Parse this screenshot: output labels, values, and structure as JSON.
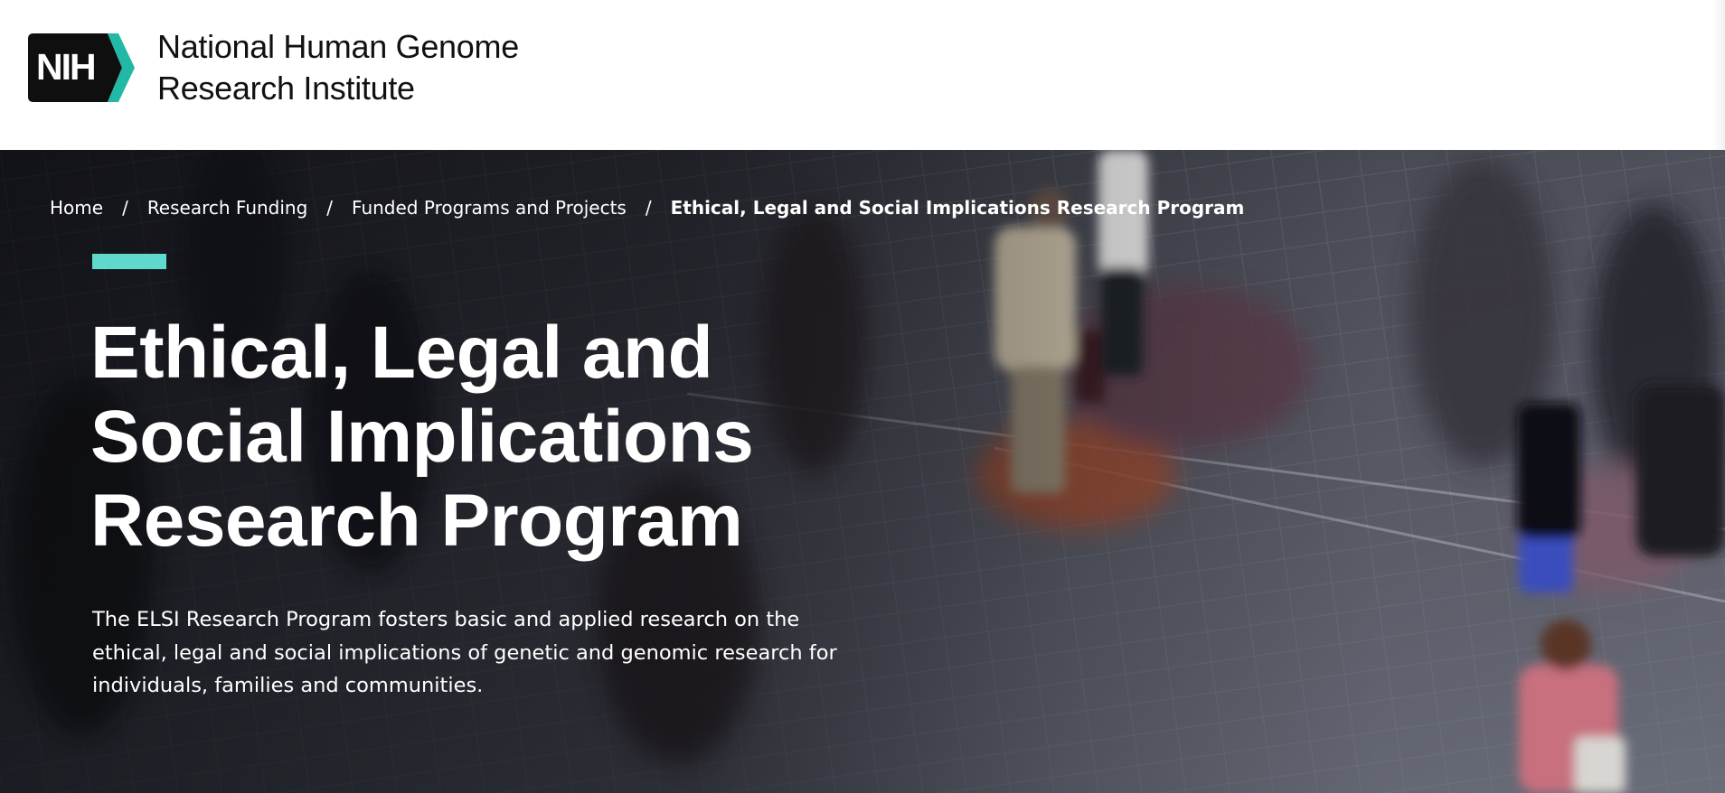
{
  "header": {
    "logo": {
      "badge_text": "NIH",
      "badge_color": "#0f0f0f",
      "chevron_color": "#21b8a6"
    },
    "org_name_lines": [
      "National Human Genome",
      "Research Institute"
    ]
  },
  "breadcrumb": {
    "items": [
      "Home",
      "Research Funding",
      "Funded Programs and Projects"
    ],
    "separator": "/",
    "current": "Ethical, Legal and Social Implications Research Program"
  },
  "hero": {
    "accent_color": "#5ed9cc",
    "title_lines": [
      "Ethical, Legal and",
      "Social Implications",
      "Research Program"
    ],
    "description_lines": [
      "The ELSI Research Program fosters basic and applied research on the",
      "ethical, legal and social implications of genetic and genomic research for",
      "individuals, families and communities."
    ]
  }
}
